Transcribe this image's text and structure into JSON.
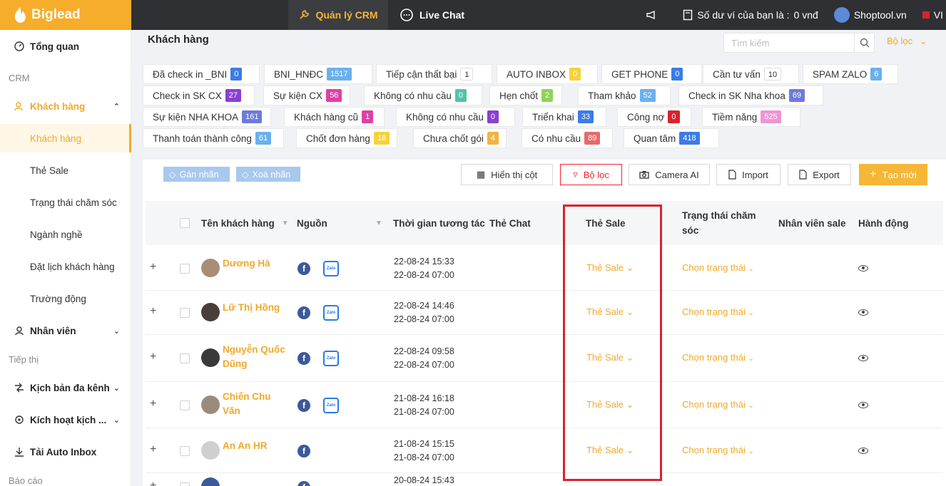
{
  "app": {
    "brand": "Biglead"
  },
  "topnav": {
    "crm": "Quản lý CRM",
    "chat": "Live Chat",
    "wallet": "Số dư ví của bạn là :",
    "wallet_value": "0 vnđ",
    "shop": "Shoptool.vn",
    "lang": "VI"
  },
  "sidebar": {
    "overview": "Tổng quan",
    "crm_section": "CRM",
    "customers_group": "Khách hàng",
    "sub": [
      "Khách hàng",
      "Thẻ Sale",
      "Trạng thái chăm sóc",
      "Ngành nghề",
      "Đặt lịch khách hàng",
      "Trường động"
    ],
    "staff": "Nhân viên",
    "marketing_section": "Tiếp thị",
    "scripts": "Kịch bản đa kênh",
    "activate": "Kích hoạt kịch ...",
    "auto_inbox": "Tải Auto Inbox",
    "report_section": "Báo cáo"
  },
  "main": {
    "title": "Khách hàng",
    "search_placeholder": "Tìm kiếm",
    "filter_toggle": "Bộ lọc"
  },
  "tags": [
    {
      "label": "Đã check in _BNI",
      "count": "0",
      "color": "#3d7be8"
    },
    {
      "label": "BNI_HNĐC",
      "count": "1517",
      "color": "#6ab0ee"
    },
    {
      "label": "Tiếp cận thất bại",
      "count": "1",
      "color": "#ffffff"
    },
    {
      "label": "AUTO INBOX",
      "count": "0",
      "color": "#f6d23a"
    },
    {
      "label": "GET PHONE",
      "count": "0",
      "color": "#3d7be8"
    },
    {
      "label": "Cần tư vấn",
      "count": "10",
      "color": "#ffffff"
    },
    {
      "label": "SPAM ZALO",
      "count": "6",
      "color": "#6ab0ee"
    },
    {
      "label": "Check in SK CX",
      "count": "27",
      "color": "#8a3fd1"
    },
    {
      "label": "Sự kiện CX",
      "count": "56",
      "color": "#e03fa6"
    },
    {
      "label": "Không có nhu cầu",
      "count": "0",
      "color": "#53c3a5"
    },
    {
      "label": "Hẹn chốt",
      "count": "2",
      "color": "#8fd25a"
    },
    {
      "label": "Tham khảo",
      "count": "52",
      "color": "#6ab0ee"
    },
    {
      "label": "Check in SK Nha khoa",
      "count": "69",
      "color": "#6c7bd9"
    },
    {
      "label": "Sự kiện NHA KHOA",
      "count": "161",
      "color": "#6c7bd9"
    },
    {
      "label": "Khách hàng cũ",
      "count": "1",
      "color": "#e03fa6"
    },
    {
      "label": "Không có nhu cầu",
      "count": "0",
      "color": "#8a3fd1"
    },
    {
      "label": "Triển khai",
      "count": "33",
      "color": "#3d7be8"
    },
    {
      "label": "Công nợ",
      "count": "0",
      "color": "#d9232b"
    },
    {
      "label": "Tiềm năng",
      "count": "525",
      "color": "#f093d4"
    },
    {
      "label": "Thanh toán thành công",
      "count": "61",
      "color": "#6ab0ee"
    },
    {
      "label": "Chốt đơn hàng",
      "count": "18",
      "color": "#f6d23a"
    },
    {
      "label": "Chưa chốt gói",
      "count": "4",
      "color": "#f2b440"
    },
    {
      "label": "Có nhu cầu",
      "count": "89",
      "color": "#e36b6b"
    },
    {
      "label": "Quan tâm",
      "count": "418",
      "color": "#3d7be8"
    }
  ],
  "toolbar": {
    "assign": "Gán nhãn",
    "remove": "Xoá nhãn",
    "columns": "Hiển thị cột",
    "filter": "Bộ lọc",
    "camera": "Camera AI",
    "import": "Import",
    "export": "Export",
    "create": "Tạo mới"
  },
  "columns": [
    "Tên khách hàng",
    "Nguồn",
    "Thời gian tương tác",
    "Thẻ Chat",
    "Thẻ Sale",
    "Trạng thái chăm sóc",
    "Nhân viên sale",
    "Hành động"
  ],
  "rows": [
    {
      "name1": "Dương Hà",
      "name2": "",
      "t1": "22-08-24 15:33",
      "t2": "22-08-24 07:00",
      "zalo": true,
      "avatar": "#a88e77"
    },
    {
      "name1": "Lữ Thị Hồng",
      "name2": "",
      "t1": "22-08-24 14:46",
      "t2": "22-08-24 07:00",
      "zalo": true,
      "avatar": "#4a3e3a"
    },
    {
      "name1": "Nguyễn Quốc",
      "name2": "Dũng",
      "t1": "22-08-24 09:58",
      "t2": "22-08-24 07:00",
      "zalo": true,
      "avatar": "#3a3a3a"
    },
    {
      "name1": "Chiến Chu",
      "name2": "Văn",
      "t1": "21-08-24 16:18",
      "t2": "21-08-24 07:00",
      "zalo": true,
      "avatar": "#9a8c7c"
    },
    {
      "name1": "An An HR",
      "name2": "",
      "t1": "21-08-24 15:15",
      "t2": "21-08-24 07:00",
      "zalo": false,
      "avatar": "#cfcfcf"
    },
    {
      "name1": "",
      "name2": "",
      "t1": "20-08-24 15:43",
      "t2": "",
      "zalo": false,
      "avatar": "#3c5a99"
    }
  ],
  "row_cells": {
    "sale_tag": "Thẻ Sale",
    "status": "Chọn trạng thái",
    "fb": "f",
    "zalo": "Zalo",
    "expand": "+"
  }
}
